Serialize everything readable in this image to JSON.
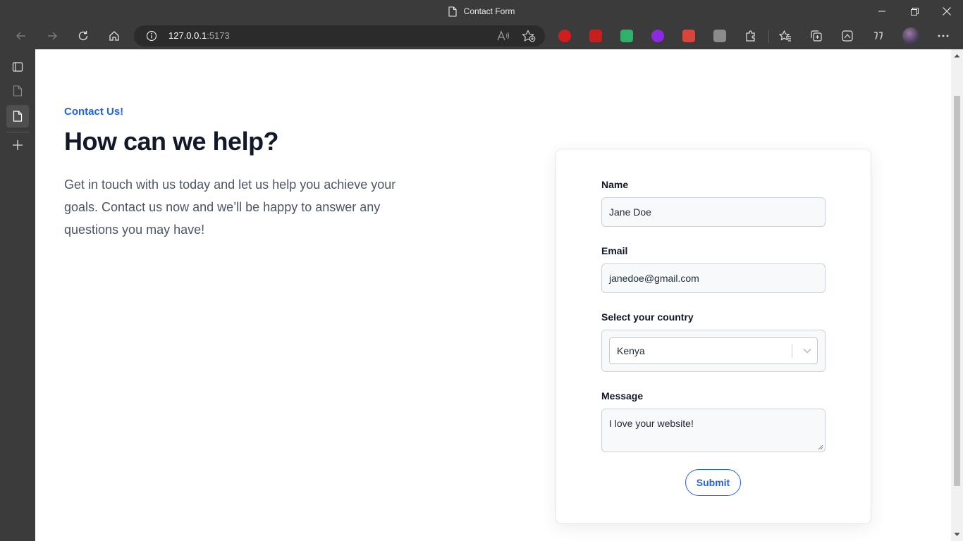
{
  "browser": {
    "tab_title": "Contact Form",
    "url_host": "127.0.0.1",
    "url_port": ":5173",
    "nav_icons": [
      "back-icon",
      "forward-icon",
      "refresh-icon",
      "home-icon"
    ],
    "address_icons": [
      "site-info-icon",
      "read-aloud-icon",
      "favorite-add-icon"
    ],
    "extensions": [
      {
        "name": "ublock-extension-icon",
        "color": "#d01e1e"
      },
      {
        "name": "color-picker-extension-icon",
        "color": "#c81e1e"
      },
      {
        "name": "green-extension-icon",
        "color": "#2fb06b"
      },
      {
        "name": "purple-extension-icon",
        "color": "#8a2be2"
      },
      {
        "name": "red-extension-icon",
        "color": "#d9453a"
      },
      {
        "name": "grey-extension-icon",
        "color": "#8b8b8b"
      }
    ],
    "toolbar_icons": [
      "extensions-icon",
      "favorites-icon",
      "collections-icon",
      "screenshot-icon",
      "quote-icon",
      "profile-avatar",
      "more-icon"
    ],
    "window_controls": [
      "minimize-icon",
      "restore-icon",
      "close-icon"
    ]
  },
  "sidebar": {
    "items": [
      "tab-actions-icon",
      "page-icon",
      "active-page-icon",
      "new-tab-icon"
    ]
  },
  "page": {
    "eyebrow": "Contact Us!",
    "headline": "How can we help?",
    "intro": "Get in touch with us today and let us help you achieve your goals. Contact us now and we’ll be happy to answer any questions you may have!"
  },
  "form": {
    "name_label": "Name",
    "name_value": "Jane Doe",
    "email_label": "Email",
    "email_value": "janedoe@gmail.com",
    "country_label": "Select your country",
    "country_value": "Kenya",
    "message_label": "Message",
    "message_value": "I love your website!",
    "submit_label": "Submit"
  },
  "colors": {
    "accent": "#2563d8",
    "heading": "#111827",
    "body_text": "#4b5563",
    "chrome": "#3b3b3b"
  }
}
